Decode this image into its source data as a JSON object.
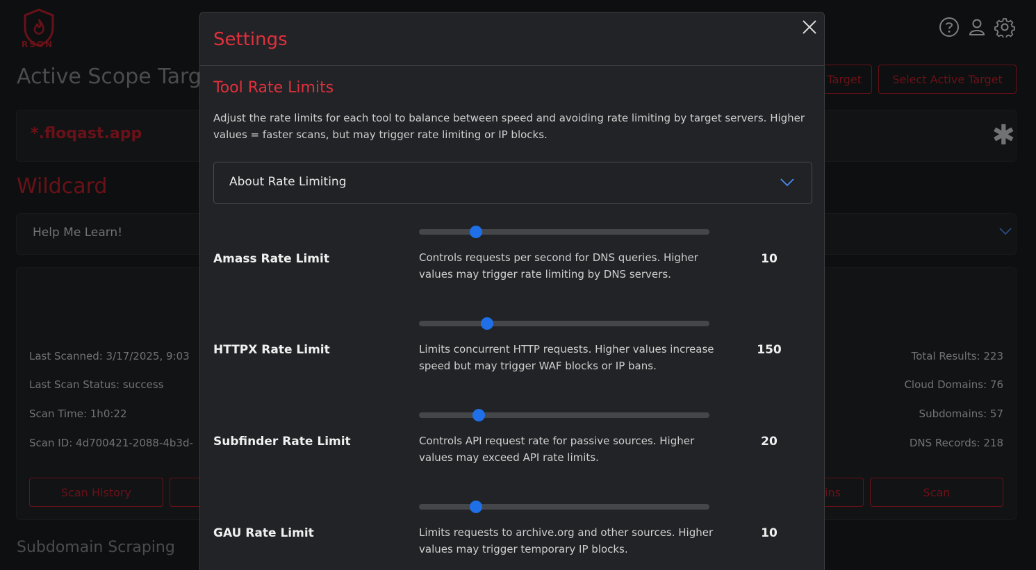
{
  "app": {
    "logo_text": "RSON"
  },
  "background": {
    "page_title": "Active Scope Targ",
    "add_target_label": "Target",
    "select_target_label": "Select Active Target",
    "target_name": "*.floqast.app",
    "target_type": "Wildcard",
    "help_label": "Help Me Learn!",
    "stats_left": [
      "Last Scanned:   3/17/2025, 9:03",
      "Last Scan Status:   success",
      "Scan Time:   1h0:22",
      "Scan ID: 4d700421-2088-4b3d-"
    ],
    "stats_right": [
      "Total Results: 223",
      "Cloud Domains: 76",
      "Subdomains: 57",
      "DNS Records: 218"
    ],
    "scan_history_label": "Scan History",
    "partial_button_label": "ins",
    "scan_label": "Scan",
    "bottom_section": "Subdomain Scraping"
  },
  "modal": {
    "title": "Settings",
    "section_title": "Tool Rate Limits",
    "section_desc": "Adjust the rate limits for each tool to balance between speed and avoiding rate limiting by target servers. Higher values = faster scans, but may trigger rate limiting or IP blocks.",
    "accordion_label": "About Rate Limiting",
    "rate_limits": [
      {
        "name": "Amass Rate Limit",
        "value": "10",
        "slider_fraction": 0.196,
        "description": "Controls requests per second for DNS queries. Higher values may trigger rate limiting by DNS servers."
      },
      {
        "name": "HTTPX Rate Limit",
        "value": "150",
        "slider_fraction": 0.234,
        "description": "Limits concurrent HTTP requests. Higher values increase speed but may trigger WAF blocks or IP bans."
      },
      {
        "name": "Subfinder Rate Limit",
        "value": "20",
        "slider_fraction": 0.206,
        "description": "Controls API request rate for passive sources. Higher values may exceed API rate limits."
      },
      {
        "name": "GAU Rate Limit",
        "value": "10",
        "slider_fraction": 0.196,
        "description": "Limits requests to archive.org and other sources. Higher values may trigger temporary IP blocks."
      }
    ]
  },
  "colors": {
    "accent": "#e0303c",
    "slider": "#1f6fe8",
    "panel": "#222326"
  },
  "icons": [
    "help-icon",
    "user-icon",
    "gear-icon",
    "close-icon",
    "chevron-down-icon",
    "logo-icon"
  ]
}
